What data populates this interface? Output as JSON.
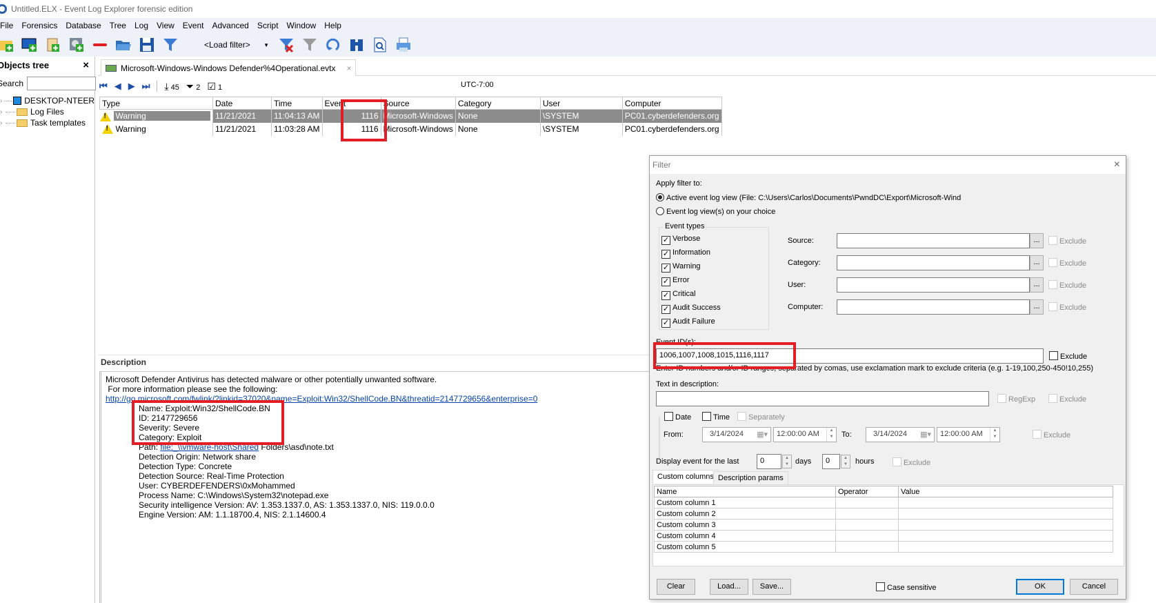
{
  "window": {
    "title": "Untitled.ELX - Event Log Explorer forensic edition"
  },
  "menu": [
    "File",
    "Forensics",
    "Database",
    "Tree",
    "Log",
    "View",
    "Event",
    "Advanced",
    "Script",
    "Window",
    "Help"
  ],
  "toolbar": {
    "load_filter_label": "<Load filter>",
    "icons": [
      "new-computer-folder-icon",
      "add-computer-icon",
      "add-log-icon",
      "add-disk-icon",
      "remove-icon",
      "open-folder-icon",
      "save-icon",
      "filter-icon",
      "clear-filter-icon",
      "filter-log-icon",
      "refresh-icon",
      "find-icon",
      "preview-icon",
      "print-icon"
    ]
  },
  "objects_tree": {
    "title": "Objects tree",
    "close": "×",
    "search_label": "Search",
    "search_value": "",
    "items": [
      {
        "label": "DESKTOP-NTEER",
        "icon": "computer-icon"
      },
      {
        "label": "Log Files",
        "icon": "folder-icon"
      },
      {
        "label": "Task templates",
        "icon": "folder-icon"
      }
    ]
  },
  "document_tab": {
    "label": "Microsoft-Windows-Windows Defender%4Operational.evtx",
    "close": "×"
  },
  "navbar": {
    "loaded_count": "45",
    "filter_count": "2",
    "checked_count": "1",
    "timezone": "UTC-7:00"
  },
  "events_table": {
    "columns": [
      "Type",
      "Date",
      "Time",
      "Event",
      "Source",
      "Category",
      "User",
      "Computer"
    ],
    "rows": [
      {
        "type": "Warning",
        "date": "11/21/2021",
        "time": "11:04:13 AM",
        "event": "1116",
        "source": "Microsoft-Windows",
        "category": "None",
        "user": "\\SYSTEM",
        "computer": "PC01.cyberdefenders.org",
        "selected": true
      },
      {
        "type": "Warning",
        "date": "11/21/2021",
        "time": "11:03:28 AM",
        "event": "1116",
        "source": "Microsoft-Windows",
        "category": "None",
        "user": "\\SYSTEM",
        "computer": "PC01.cyberdefenders.org",
        "selected": false
      }
    ]
  },
  "description": {
    "title": "Description",
    "intro": "Microsoft Defender Antivirus has detected malware or other potentially unwanted software.",
    "more_info": " For more information please see the following:",
    "link": "http://go.microsoft.com/fwlink/?linkid=37020&name=Exploit:Win32/ShellCode.BN&threatid=2147729656&enterprise=0",
    "name": "Name: Exploit:Win32/ShellCode.BN",
    "id": "ID: 2147729656",
    "severity": "Severity: Severe",
    "category": "Category: Exploit",
    "path_label": "Path: ",
    "path_link": "file:_\\\\vmware-host\\Shared",
    "path_rest": " Folders\\asd\\note.txt",
    "detection_origin": "Detection Origin: Network share",
    "detection_type": "Detection Type: Concrete",
    "detection_source": "Detection Source: Real-Time Protection",
    "user": "User: CYBERDEFENDERS\\0xMohammed",
    "process_name": "Process Name: C:\\Windows\\System32\\notepad.exe",
    "security_intel": "Security intelligence Version: AV: 1.353.1337.0, AS: 1.353.1337.0, NIS: 119.0.0.0",
    "engine_version": "Engine Version: AM: 1.1.18700.4, NIS: 2.1.14600.4"
  },
  "filter_dialog": {
    "title": "Filter",
    "apply_to_label": "Apply filter to:",
    "radio_active": "Active event log view (File: C:\\Users\\Carlos\\Documents\\PwndDC\\Export\\Microsoft-Wind",
    "radio_choice": "Event log view(s) on your choice",
    "event_types_label": "Event types",
    "event_types": [
      {
        "label": "Verbose",
        "checked": true
      },
      {
        "label": "Information",
        "checked": true
      },
      {
        "label": "Warning",
        "checked": true
      },
      {
        "label": "Error",
        "checked": true
      },
      {
        "label": "Critical",
        "checked": true
      },
      {
        "label": "Audit Success",
        "checked": true
      },
      {
        "label": "Audit Failure",
        "checked": true
      }
    ],
    "fields": [
      {
        "label": "Source:",
        "value": ""
      },
      {
        "label": "Category:",
        "value": ""
      },
      {
        "label": "User:",
        "value": ""
      },
      {
        "label": "Computer:",
        "value": ""
      }
    ],
    "ellipsis": "...",
    "exclude_label": "Exclude",
    "event_ids_label": "Event ID(s):",
    "event_ids_value": "1006,1007,1008,1015,1116,1117",
    "event_ids_hint": "Enter ID numbers and/or ID ranges, separated by comas, use exclamation mark to exclude criteria (e.g. 1-19,100,250-450!10,255)",
    "text_desc_label": "Text in description:",
    "text_desc_value": "",
    "regexp_label": "RegExp",
    "date_label": "Date",
    "time_label": "Time",
    "separately_label": "Separately",
    "from_label": "From:",
    "to_label": "To:",
    "from_date": "3/14/2024",
    "from_time": "12:00:00 AM",
    "to_date": "3/14/2024",
    "to_time": "12:00:00 AM",
    "display_last_label": "Display event for the last",
    "days_value": "0",
    "days_label": "days",
    "hours_value": "0",
    "hours_label": "hours",
    "tabs": [
      "Custom columns",
      "Description params"
    ],
    "custom_columns": {
      "headers": [
        "Name",
        "Operator",
        "Value"
      ],
      "rows": [
        "Custom column 1",
        "Custom column 2",
        "Custom column 3",
        "Custom column 4",
        "Custom column 5"
      ]
    },
    "buttons": {
      "clear": "Clear",
      "load": "Load...",
      "save": "Save...",
      "ok": "OK",
      "cancel": "Cancel"
    },
    "case_sensitive_label": "Case sensitive",
    "close": "×"
  },
  "colors": {
    "highlight_red": "#e41c24",
    "selected_row": "#8c8c8c",
    "link_blue": "#0645ad",
    "ok_border": "#0078d7"
  }
}
